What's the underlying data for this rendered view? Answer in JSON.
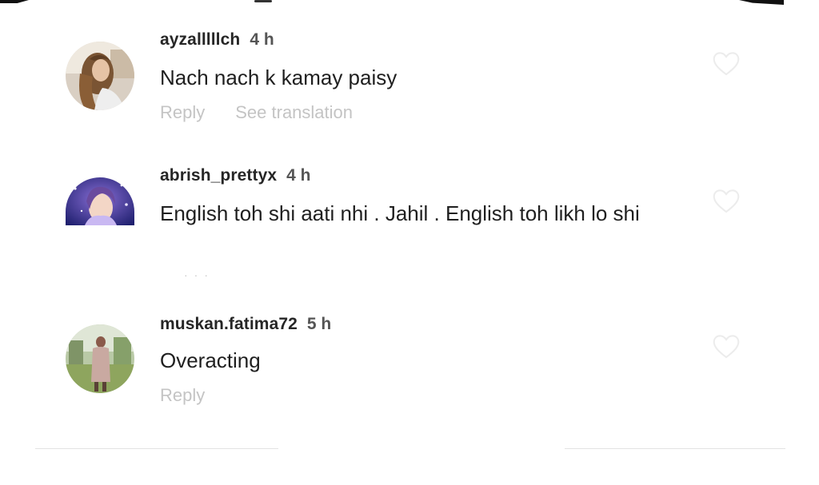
{
  "comments": [
    {
      "username": "ayzalllllch",
      "time": "4 h",
      "text": "Nach nach k kamay paisy",
      "reply_label": "Reply",
      "translate_label": "See translation"
    },
    {
      "username": "abrish_prettyx",
      "time": "4 h",
      "text": "English toh shi aati nhi . Jahil . English toh likh lo shi"
    },
    {
      "username": "muskan.fatima72",
      "time": "5 h",
      "text": "Overacting",
      "reply_label": "Reply"
    }
  ],
  "icons": {
    "like": "heart-outline-icon"
  },
  "colors": {
    "username": "#262626",
    "muted_action": "#c4c4c4",
    "heart_outline": "#ececec"
  }
}
